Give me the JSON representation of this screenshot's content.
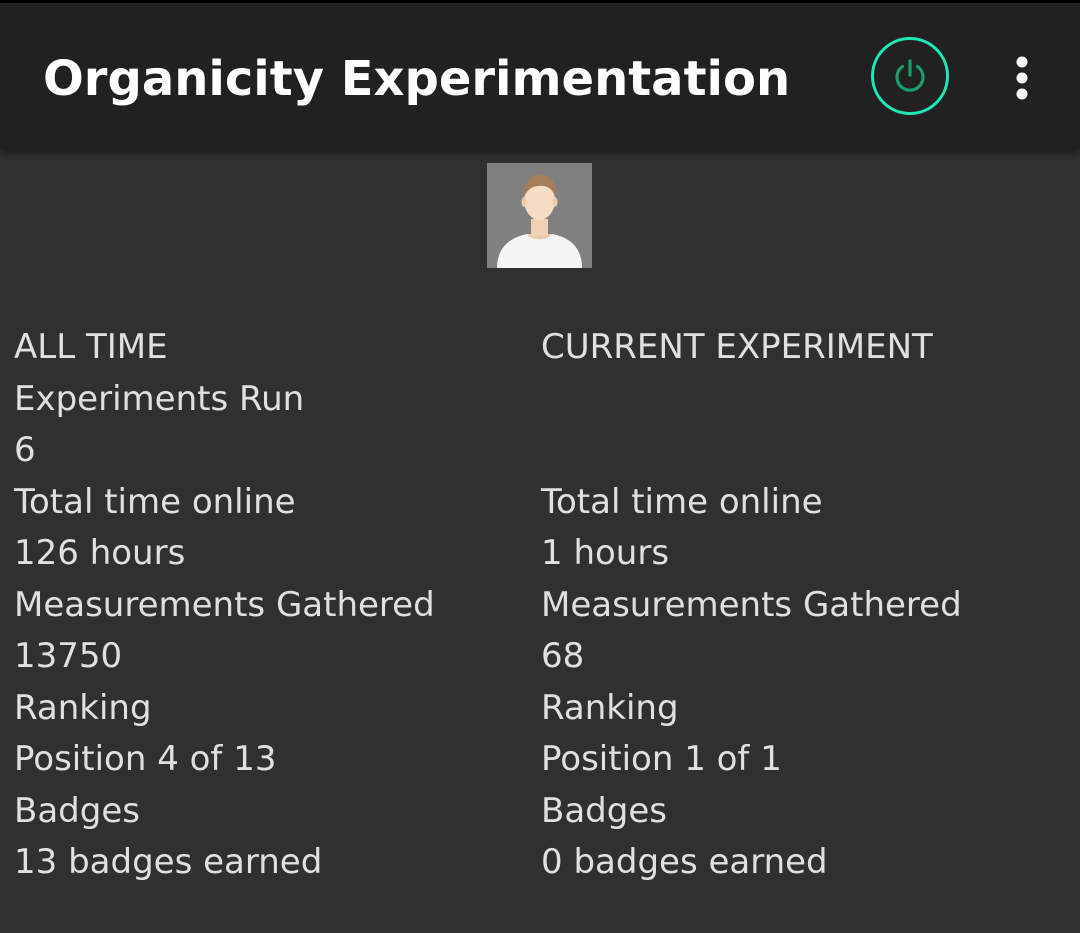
{
  "app_bar": {
    "title": "Organicity Experimentation",
    "power_icon": "power-icon",
    "overflow_icon": "more-vertical-icon",
    "accent_color": "#1de9b6"
  },
  "profile": {
    "avatar_icon": "user-avatar"
  },
  "all_time": {
    "heading": "ALL TIME",
    "experiments_label": "Experiments Run",
    "experiments_value": "6",
    "time_label": "Total time online",
    "time_value": "126 hours",
    "measurements_label": "Measurements Gathered",
    "measurements_value": "13750",
    "ranking_label": "Ranking",
    "ranking_value": "Position 4 of 13",
    "badges_label": "Badges",
    "badges_value": "13 badges earned"
  },
  "current": {
    "heading": "CURRENT EXPERIMENT",
    "time_label": "Total time online",
    "time_value": "1 hours",
    "measurements_label": "Measurements Gathered",
    "measurements_value": "68",
    "ranking_label": "Ranking",
    "ranking_value": "Position 1 of 1",
    "badges_label": "Badges",
    "badges_value": "0 badges earned"
  }
}
